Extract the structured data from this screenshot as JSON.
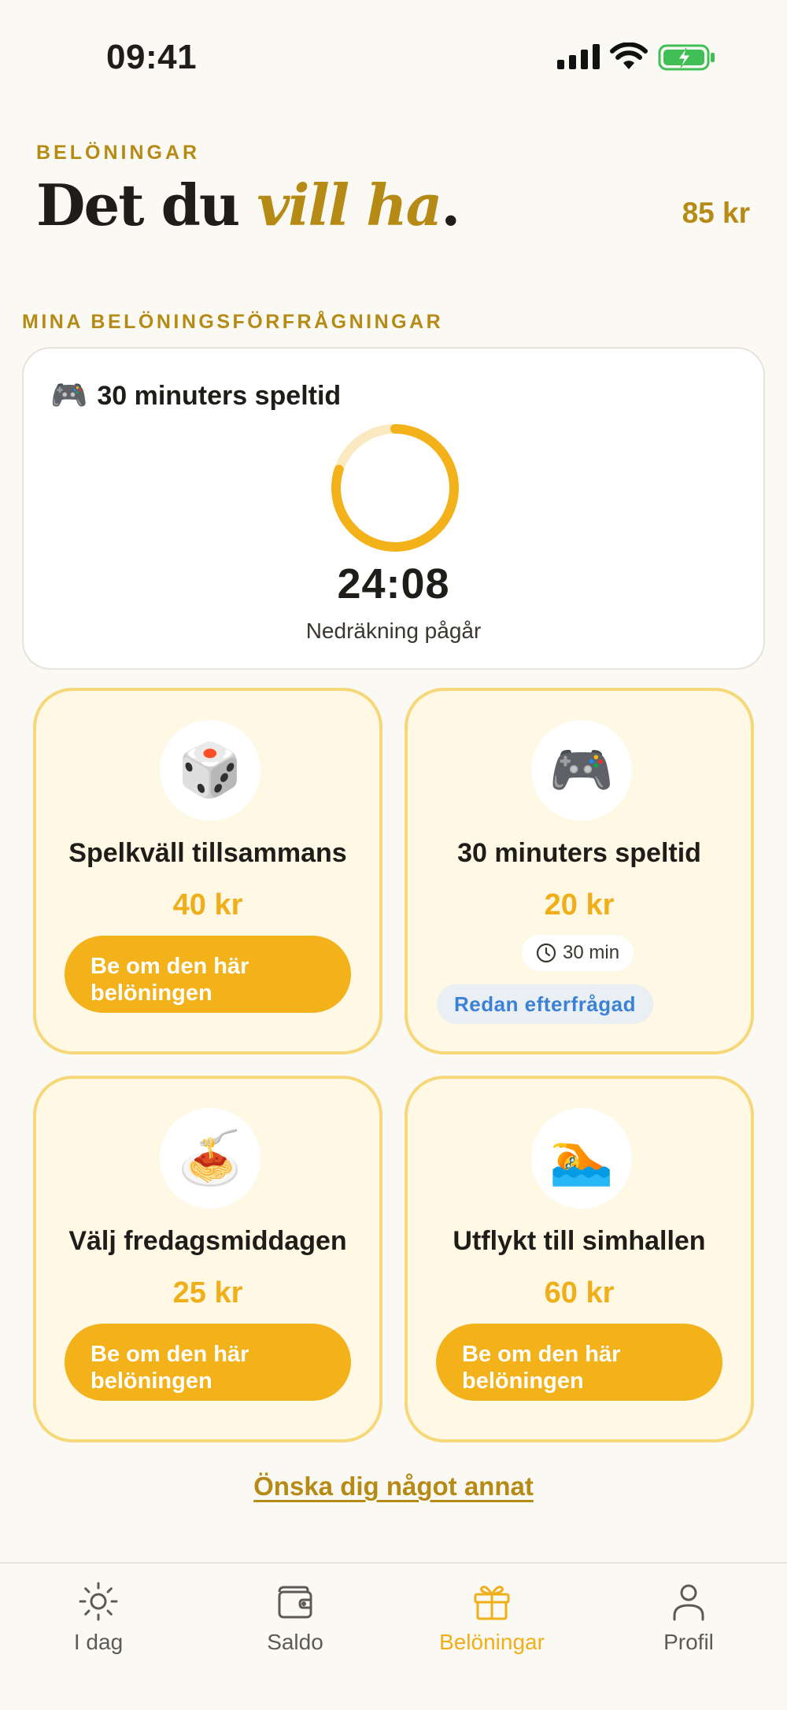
{
  "status_bar": {
    "time": "09:41"
  },
  "header": {
    "eyebrow": "BELÖNINGAR",
    "title_start": "Det du ",
    "title_accent": "vill ha",
    "title_end": ".",
    "balance": "85 kr"
  },
  "requests": {
    "section_label": "MINA BELÖNINGSFÖRFRÅGNINGAR",
    "active": {
      "icon": "game-controller",
      "emoji": "🎮",
      "title": "30 minuters speltid",
      "countdown": "24:08",
      "countdown_label": "Nedräkning pågår",
      "remaining_fraction": 0.8
    }
  },
  "rewards": [
    {
      "icon": "dice",
      "emoji": "🎲",
      "name": "Spelkväll tillsammans",
      "price": "40 kr",
      "button": "Be om den här belöningen"
    },
    {
      "icon": "game-controller",
      "emoji": "🎮",
      "name": "30 minuters speltid",
      "price": "20 kr",
      "duration": "30 min",
      "status": "Redan efterfrågad"
    },
    {
      "icon": "spaghetti",
      "emoji": "🍝",
      "name": "Välj fredagsmiddagen",
      "price": "25 kr",
      "button": "Be om den här belöningen"
    },
    {
      "icon": "swimmer",
      "emoji": "🏊",
      "name": "Utflykt till simhallen",
      "price": "60 kr",
      "button": "Be om den här belöningen"
    }
  ],
  "wish_link": "Önska dig något annat",
  "tabs": [
    {
      "label": "I dag",
      "icon": "sun"
    },
    {
      "label": "Saldo",
      "icon": "wallet"
    },
    {
      "label": "Belöningar",
      "icon": "gift",
      "active": true
    },
    {
      "label": "Profil",
      "icon": "person"
    }
  ],
  "colors": {
    "accent": "#F3B11A",
    "gold_text": "#B58A15",
    "card_bg": "#FEF8E5",
    "card_border": "#F6D77A",
    "ring_track": "#FBE9C2",
    "link_blue": "#3B82D6"
  }
}
